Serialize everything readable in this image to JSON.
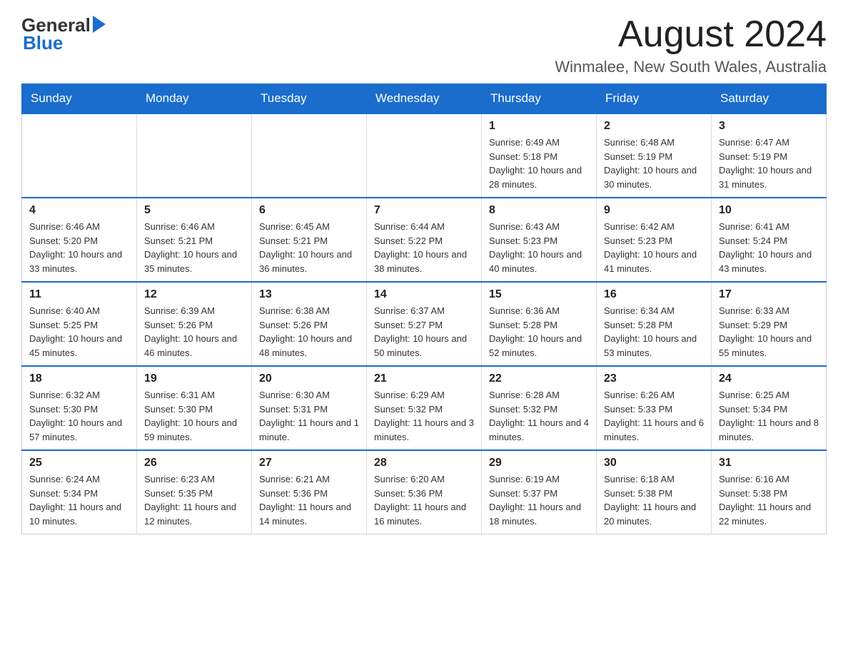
{
  "header": {
    "logo_general": "General",
    "logo_blue": "Blue",
    "month_year": "August 2024",
    "location": "Winmalee, New South Wales, Australia"
  },
  "days_of_week": [
    "Sunday",
    "Monday",
    "Tuesday",
    "Wednesday",
    "Thursday",
    "Friday",
    "Saturday"
  ],
  "weeks": [
    [
      {
        "day": "",
        "info": ""
      },
      {
        "day": "",
        "info": ""
      },
      {
        "day": "",
        "info": ""
      },
      {
        "day": "",
        "info": ""
      },
      {
        "day": "1",
        "info": "Sunrise: 6:49 AM\nSunset: 5:18 PM\nDaylight: 10 hours and 28 minutes."
      },
      {
        "day": "2",
        "info": "Sunrise: 6:48 AM\nSunset: 5:19 PM\nDaylight: 10 hours and 30 minutes."
      },
      {
        "day": "3",
        "info": "Sunrise: 6:47 AM\nSunset: 5:19 PM\nDaylight: 10 hours and 31 minutes."
      }
    ],
    [
      {
        "day": "4",
        "info": "Sunrise: 6:46 AM\nSunset: 5:20 PM\nDaylight: 10 hours and 33 minutes."
      },
      {
        "day": "5",
        "info": "Sunrise: 6:46 AM\nSunset: 5:21 PM\nDaylight: 10 hours and 35 minutes."
      },
      {
        "day": "6",
        "info": "Sunrise: 6:45 AM\nSunset: 5:21 PM\nDaylight: 10 hours and 36 minutes."
      },
      {
        "day": "7",
        "info": "Sunrise: 6:44 AM\nSunset: 5:22 PM\nDaylight: 10 hours and 38 minutes."
      },
      {
        "day": "8",
        "info": "Sunrise: 6:43 AM\nSunset: 5:23 PM\nDaylight: 10 hours and 40 minutes."
      },
      {
        "day": "9",
        "info": "Sunrise: 6:42 AM\nSunset: 5:23 PM\nDaylight: 10 hours and 41 minutes."
      },
      {
        "day": "10",
        "info": "Sunrise: 6:41 AM\nSunset: 5:24 PM\nDaylight: 10 hours and 43 minutes."
      }
    ],
    [
      {
        "day": "11",
        "info": "Sunrise: 6:40 AM\nSunset: 5:25 PM\nDaylight: 10 hours and 45 minutes."
      },
      {
        "day": "12",
        "info": "Sunrise: 6:39 AM\nSunset: 5:26 PM\nDaylight: 10 hours and 46 minutes."
      },
      {
        "day": "13",
        "info": "Sunrise: 6:38 AM\nSunset: 5:26 PM\nDaylight: 10 hours and 48 minutes."
      },
      {
        "day": "14",
        "info": "Sunrise: 6:37 AM\nSunset: 5:27 PM\nDaylight: 10 hours and 50 minutes."
      },
      {
        "day": "15",
        "info": "Sunrise: 6:36 AM\nSunset: 5:28 PM\nDaylight: 10 hours and 52 minutes."
      },
      {
        "day": "16",
        "info": "Sunrise: 6:34 AM\nSunset: 5:28 PM\nDaylight: 10 hours and 53 minutes."
      },
      {
        "day": "17",
        "info": "Sunrise: 6:33 AM\nSunset: 5:29 PM\nDaylight: 10 hours and 55 minutes."
      }
    ],
    [
      {
        "day": "18",
        "info": "Sunrise: 6:32 AM\nSunset: 5:30 PM\nDaylight: 10 hours and 57 minutes."
      },
      {
        "day": "19",
        "info": "Sunrise: 6:31 AM\nSunset: 5:30 PM\nDaylight: 10 hours and 59 minutes."
      },
      {
        "day": "20",
        "info": "Sunrise: 6:30 AM\nSunset: 5:31 PM\nDaylight: 11 hours and 1 minute."
      },
      {
        "day": "21",
        "info": "Sunrise: 6:29 AM\nSunset: 5:32 PM\nDaylight: 11 hours and 3 minutes."
      },
      {
        "day": "22",
        "info": "Sunrise: 6:28 AM\nSunset: 5:32 PM\nDaylight: 11 hours and 4 minutes."
      },
      {
        "day": "23",
        "info": "Sunrise: 6:26 AM\nSunset: 5:33 PM\nDaylight: 11 hours and 6 minutes."
      },
      {
        "day": "24",
        "info": "Sunrise: 6:25 AM\nSunset: 5:34 PM\nDaylight: 11 hours and 8 minutes."
      }
    ],
    [
      {
        "day": "25",
        "info": "Sunrise: 6:24 AM\nSunset: 5:34 PM\nDaylight: 11 hours and 10 minutes."
      },
      {
        "day": "26",
        "info": "Sunrise: 6:23 AM\nSunset: 5:35 PM\nDaylight: 11 hours and 12 minutes."
      },
      {
        "day": "27",
        "info": "Sunrise: 6:21 AM\nSunset: 5:36 PM\nDaylight: 11 hours and 14 minutes."
      },
      {
        "day": "28",
        "info": "Sunrise: 6:20 AM\nSunset: 5:36 PM\nDaylight: 11 hours and 16 minutes."
      },
      {
        "day": "29",
        "info": "Sunrise: 6:19 AM\nSunset: 5:37 PM\nDaylight: 11 hours and 18 minutes."
      },
      {
        "day": "30",
        "info": "Sunrise: 6:18 AM\nSunset: 5:38 PM\nDaylight: 11 hours and 20 minutes."
      },
      {
        "day": "31",
        "info": "Sunrise: 6:16 AM\nSunset: 5:38 PM\nDaylight: 11 hours and 22 minutes."
      }
    ]
  ]
}
